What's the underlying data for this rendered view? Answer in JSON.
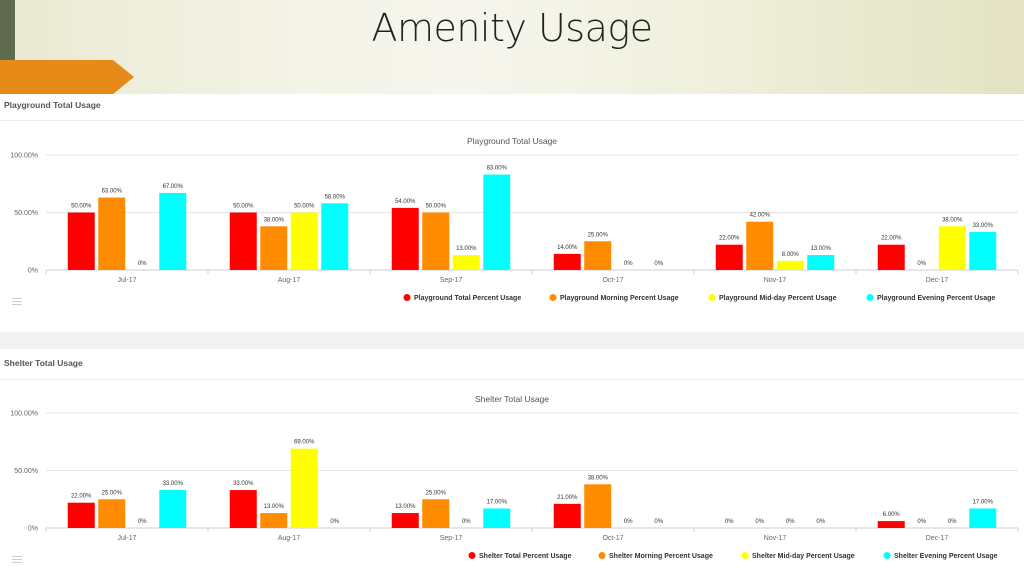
{
  "slide": {
    "title": "Amenity Usage"
  },
  "panels": [
    {
      "header": "Playground Total Usage"
    },
    {
      "header": "Shelter Total Usage"
    }
  ],
  "colors": {
    "total": "#ff0000",
    "morning": "#ff8c00",
    "midday": "#ffff00",
    "evening": "#00ffff",
    "accent_orange": "#e68a18",
    "accent_green": "#5f6b4f"
  },
  "chart_data": [
    {
      "type": "bar",
      "title": "Playground Total Usage",
      "xlabel": "",
      "ylabel": "",
      "categories": [
        "Jul-17",
        "Aug-17",
        "Sep-17",
        "Oct-17",
        "Nov-17",
        "Dec-17"
      ],
      "yticks": [
        "0%",
        "50.00%",
        "100.00%"
      ],
      "ylim": [
        0,
        100
      ],
      "grid": true,
      "legend_position": "bottom-right",
      "series": [
        {
          "name": "Playground Total Percent Usage",
          "color": "#ff0000",
          "values": [
            50,
            50,
            54,
            14,
            22,
            22
          ],
          "labels": [
            "50.00%",
            "50.00%",
            "54.00%",
            "14.00%",
            "22.00%",
            "22.00%"
          ]
        },
        {
          "name": "Playground Morning Percent Usage",
          "color": "#ff8c00",
          "values": [
            63,
            38,
            50,
            25,
            42,
            0
          ],
          "labels": [
            "63.00%",
            "38.00%",
            "50.00%",
            "25.00%",
            "42.00%",
            "0%"
          ]
        },
        {
          "name": "Playground Mid-day Percent Usage",
          "color": "#ffff00",
          "values": [
            0,
            50,
            13,
            0,
            8,
            38
          ],
          "labels": [
            "0%",
            "50.00%",
            "13.00%",
            "0%",
            "8.00%",
            "38.00%"
          ]
        },
        {
          "name": "Playground Evening Percent Usage",
          "color": "#00ffff",
          "values": [
            67,
            58,
            83,
            0,
            13,
            33
          ],
          "labels": [
            "67.00%",
            "58.00%",
            "83.00%",
            "0%",
            "13.00%",
            "33.00%"
          ]
        }
      ]
    },
    {
      "type": "bar",
      "title": "Shelter Total Usage",
      "xlabel": "",
      "ylabel": "",
      "categories": [
        "Jul-17",
        "Aug-17",
        "Sep-17",
        "Oct-17",
        "Nov-17",
        "Dec-17"
      ],
      "yticks": [
        "0%",
        "50.00%",
        "100.00%"
      ],
      "ylim": [
        0,
        100
      ],
      "grid": true,
      "legend_position": "bottom-right",
      "series": [
        {
          "name": "Shelter Total Percent Usage",
          "color": "#ff0000",
          "values": [
            22,
            33,
            13,
            21,
            0,
            6
          ],
          "labels": [
            "22.00%",
            "33.00%",
            "13.00%",
            "21.00%",
            "0%",
            "6.00%"
          ]
        },
        {
          "name": "Shelter Morning Percent Usage",
          "color": "#ff8c00",
          "values": [
            25,
            13,
            25,
            38,
            0,
            0
          ],
          "labels": [
            "25.00%",
            "13.00%",
            "25.00%",
            "38.00%",
            "0%",
            "0%"
          ]
        },
        {
          "name": "Shelter Mid-day Percent Usage",
          "color": "#ffff00",
          "values": [
            0,
            69,
            0,
            0,
            0,
            0
          ],
          "labels": [
            "0%",
            "69.00%",
            "0%",
            "0%",
            "0%",
            "0%"
          ]
        },
        {
          "name": "Shelter Evening Percent Usage",
          "color": "#00ffff",
          "values": [
            33,
            0,
            17,
            0,
            0,
            17
          ],
          "labels": [
            "33.00%",
            "0%",
            "17.00%",
            "0%",
            "0%",
            "17.00%"
          ]
        }
      ]
    }
  ]
}
